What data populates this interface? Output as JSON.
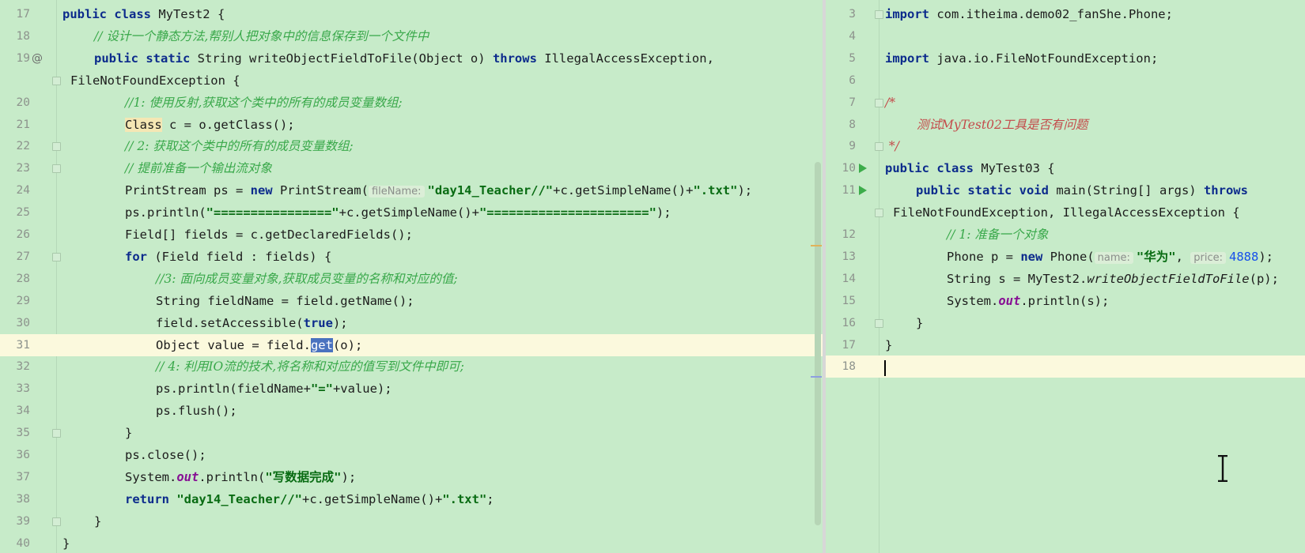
{
  "left": {
    "lines": [
      {
        "n": "17"
      },
      {
        "n": "18"
      },
      {
        "n": "19"
      },
      {
        "n": ""
      },
      {
        "n": "20"
      },
      {
        "n": "21"
      },
      {
        "n": "22"
      },
      {
        "n": "23"
      },
      {
        "n": "24"
      },
      {
        "n": "25"
      },
      {
        "n": "26"
      },
      {
        "n": "27"
      },
      {
        "n": "28"
      },
      {
        "n": "29"
      },
      {
        "n": "30"
      },
      {
        "n": "31"
      },
      {
        "n": "32"
      },
      {
        "n": "33"
      },
      {
        "n": "34"
      },
      {
        "n": "35"
      },
      {
        "n": "36"
      },
      {
        "n": "37"
      },
      {
        "n": "38"
      },
      {
        "n": "39"
      },
      {
        "n": "40"
      }
    ],
    "gutter_icon": "@",
    "t": {
      "l17a": "public class",
      "l17b": " MyTest2 {",
      "l18": "// 设计一个静态方法,帮别人把对象中的信息保存到一个文件中",
      "l19a": "public static",
      "l19b": " String writeObjectFieldToFile(Object o) ",
      "l19c": "throws",
      "l19d": " IllegalAccessException,",
      "l19w": "FileNotFoundException {",
      "l20": "//1: 使用反射,获取这个类中的所有的成员变量数组;",
      "l21a": "Class",
      "l21b": " c = o.getClass();",
      "l22": "// 2: 获取这个类中的所有的成员变量数组;",
      "l23": "// 提前准备一个输出流对象",
      "l24a": "PrintStream ps = ",
      "l24b": "new",
      "l24c": " PrintStream(",
      "l24hint": "fileName:",
      "l24d": "\"day14_Teacher//\"",
      "l24e": "+c.getSimpleName()+",
      "l24f": "\".txt\"",
      "l24g": ");",
      "l25a": "ps.println(",
      "l25b": "\"================\"",
      "l25c": "+c.getSimpleName()+",
      "l25d": "\"======================\"",
      "l25e": ");",
      "l26": "Field[] fields = c.getDeclaredFields();",
      "l27a": "for",
      "l27b": " (Field field : fields) {",
      "l28": "//3: 面向成员变量对象,获取成员变量的名称和对应的值;",
      "l29": "String fieldName = field.getName();",
      "l30a": "field.setAccessible(",
      "l30b": "true",
      "l30c": ");",
      "l31a": "Object value = field.",
      "l31b": "get",
      "l31c": "(o);",
      "l32": "// 4: 利用IO流的技术,将名称和对应的值写到文件中即可;",
      "l33a": "ps.println(fieldName+",
      "l33b": "\"=\"",
      "l33c": "+value);",
      "l34": "ps.flush();",
      "l35": "}",
      "l36": "ps.close();",
      "l37a": "System.",
      "l37b": "out",
      "l37c": ".println(",
      "l37d": "\"写数据完成\"",
      "l37e": ");",
      "l38a": "return",
      "l38b": " ",
      "l38c": "\"day14_Teacher//\"",
      "l38d": "+c.getSimpleName()+",
      "l38e": "\".txt\"",
      "l38f": ";",
      "l39": "}",
      "l40": "}"
    }
  },
  "right": {
    "lines": [
      {
        "n": "3"
      },
      {
        "n": "4"
      },
      {
        "n": "5"
      },
      {
        "n": "6"
      },
      {
        "n": "7"
      },
      {
        "n": "8"
      },
      {
        "n": "9"
      },
      {
        "n": "10"
      },
      {
        "n": "11"
      },
      {
        "n": ""
      },
      {
        "n": "12"
      },
      {
        "n": "13"
      },
      {
        "n": "14"
      },
      {
        "n": "15"
      },
      {
        "n": "16"
      },
      {
        "n": "17"
      },
      {
        "n": "18"
      }
    ],
    "t": {
      "r3a": "import",
      "r3b": " com.itheima.demo02_fanShe.Phone;",
      "r5a": "import",
      "r5b": " java.io.FileNotFoundException;",
      "r7": "/*",
      "r8": "测试MyTest02工具是否有问题",
      "r9": " */",
      "r10a": "public class",
      "r10b": " MyTest03 {",
      "r11a": "public static void",
      "r11b": " main(String[] args) ",
      "r11c": "throws",
      "r11w": "FileNotFoundException, IllegalAccessException {",
      "r12": "// 1: 准备一个对象",
      "r13a": "Phone p = ",
      "r13b": "new",
      "r13c": " Phone(",
      "r13h1": "name:",
      "r13d": "\"华为\"",
      "r13e": ", ",
      "r13h2": "price:",
      "r13f": "4888",
      "r13g": ");",
      "r14a": "String s = MyTest2.",
      "r14b": "writeObjectFieldToFile",
      "r14c": "(p);",
      "r15a": "System.",
      "r15b": "out",
      "r15c": ".println(s);",
      "r16": "}",
      "r17": "}"
    }
  },
  "colors": {
    "background": "#c7ebc9",
    "current_line": "#fbf9dd",
    "keyword": "#0c2b8c",
    "string": "#086b12",
    "comment": "#39a84a",
    "selection": "#4a72bf",
    "run_icon": "#3cac4a"
  },
  "icons": [
    "run-icon",
    "fold-icon",
    "override-at-icon",
    "text-cursor-icon"
  ]
}
